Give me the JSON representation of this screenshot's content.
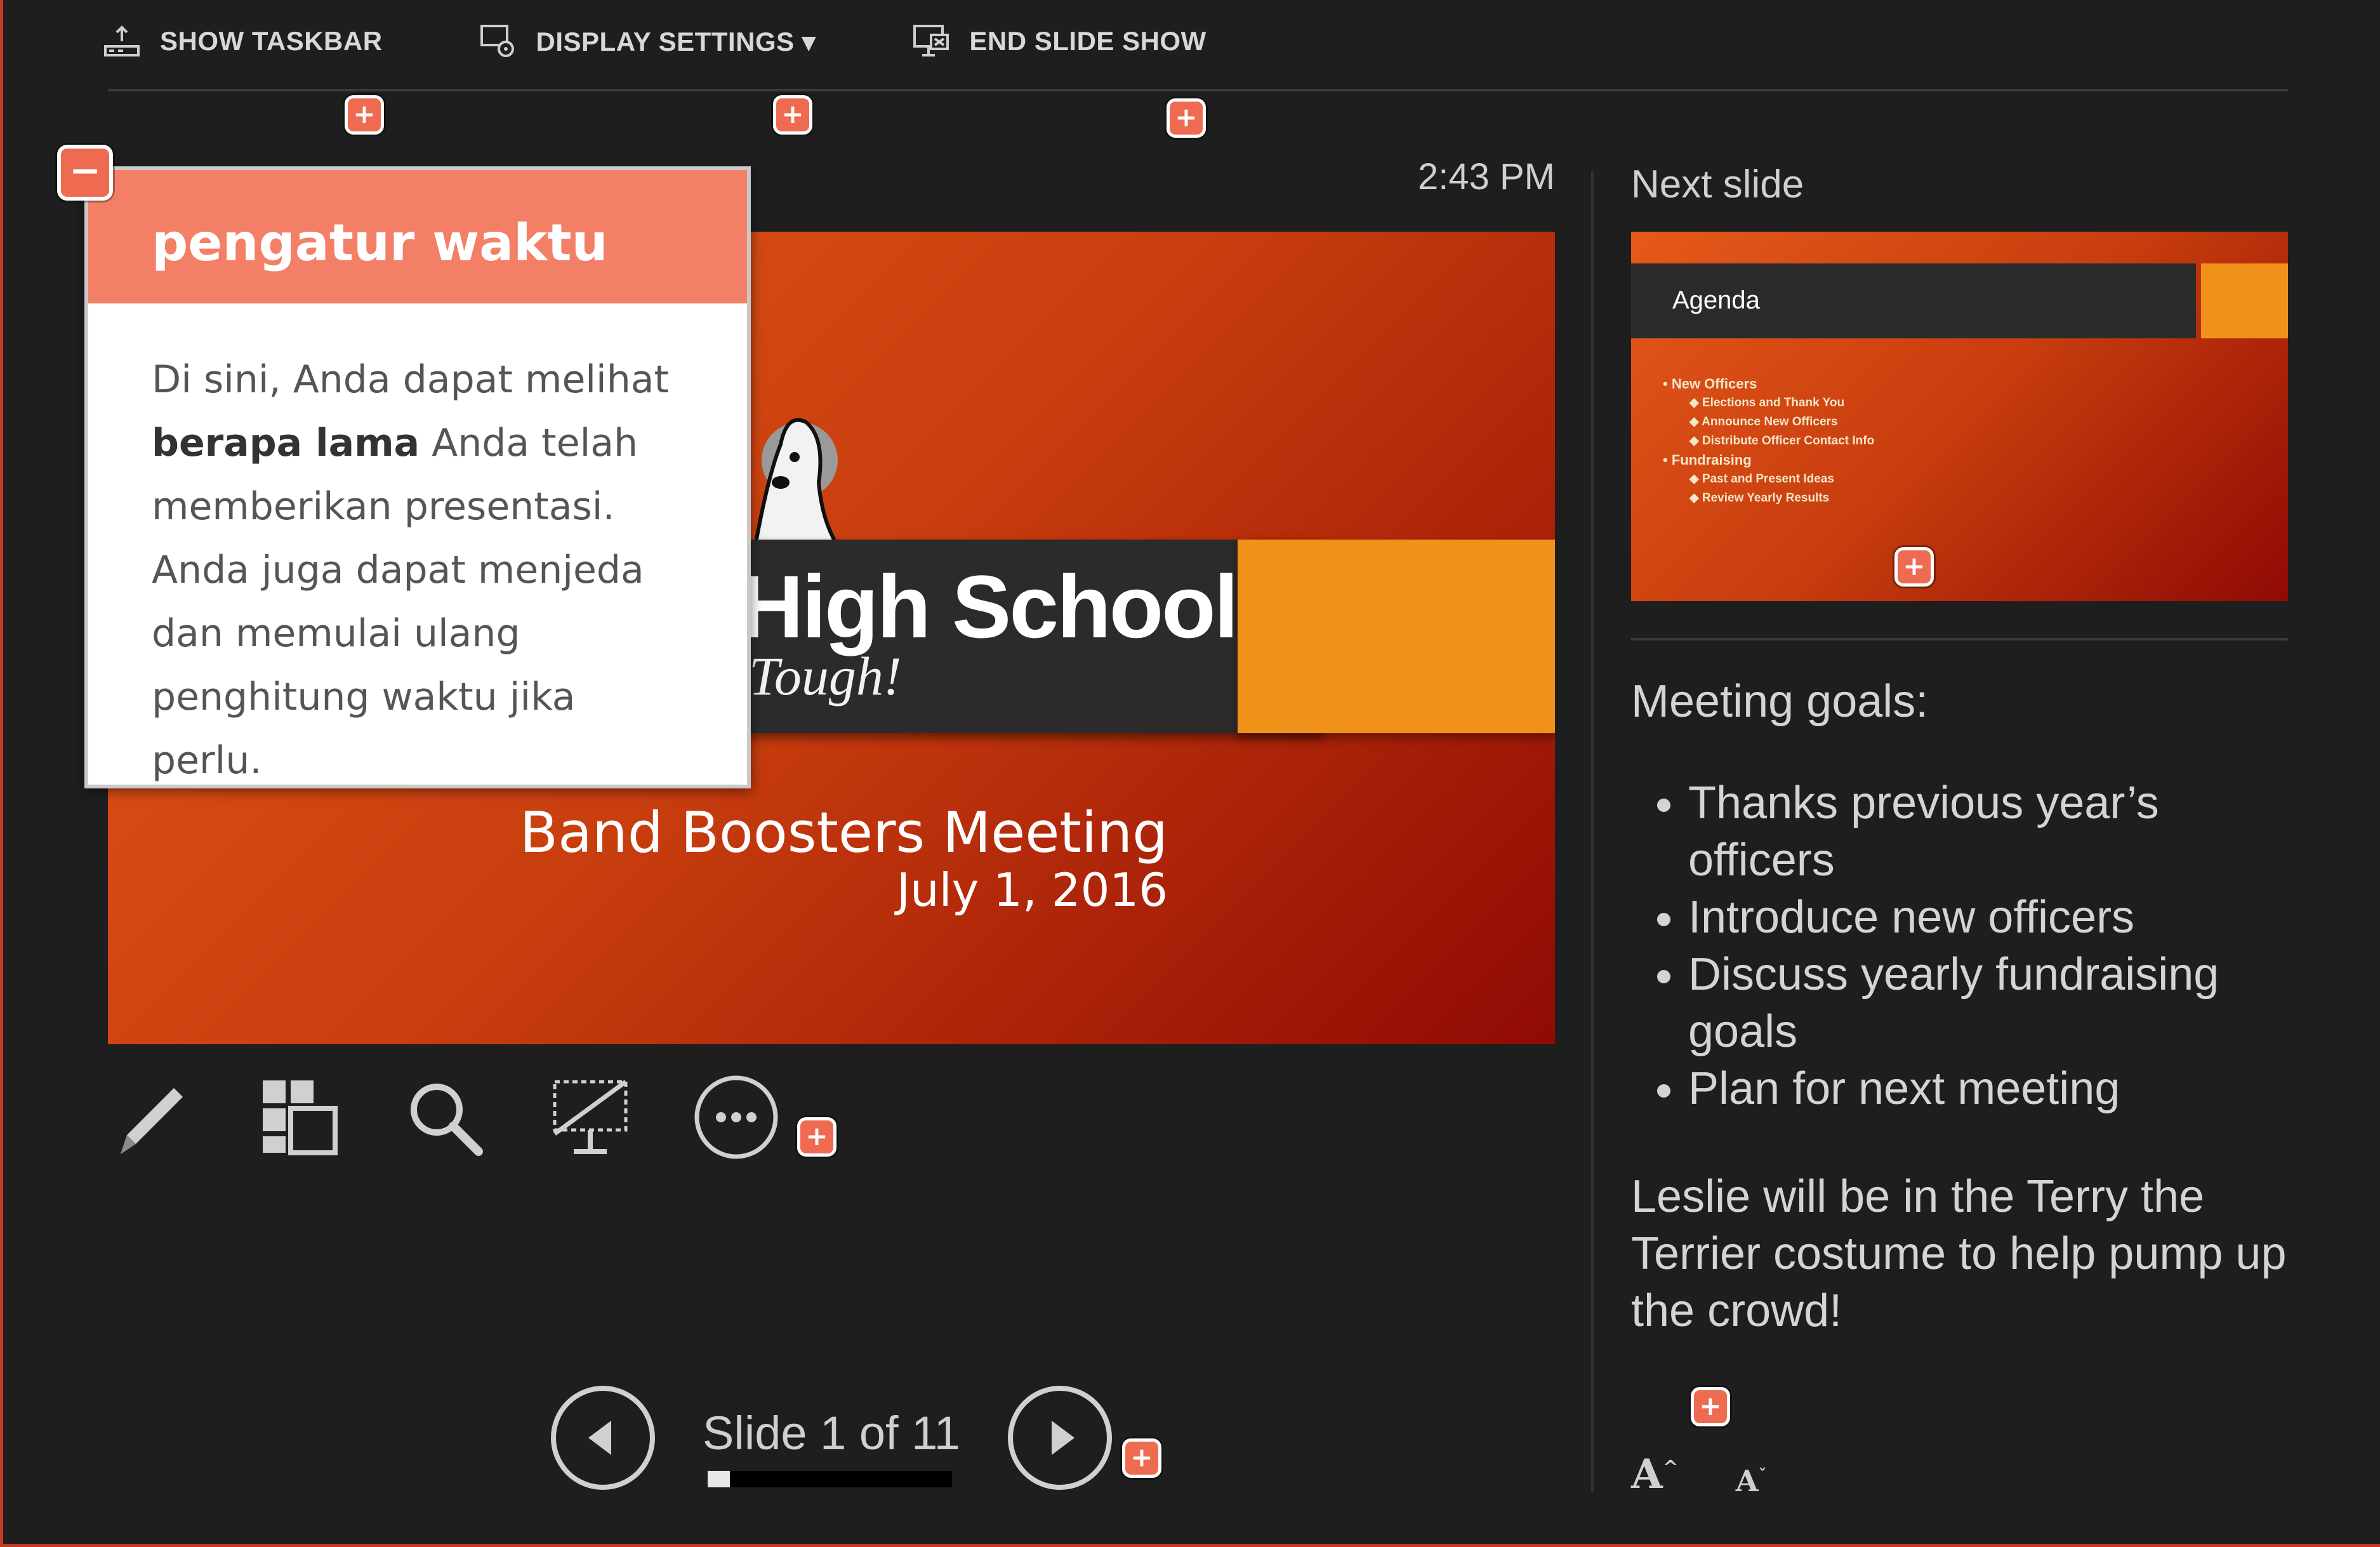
{
  "toolbar": {
    "show_taskbar": "SHOW TASKBAR",
    "display_settings": "DISPLAY SETTINGS ▾",
    "end_slide_show": "END SLIDE SHOW"
  },
  "clock": "2:43 PM",
  "current_slide": {
    "school_name": "High School",
    "tagline": "Tough!",
    "meeting_title": "Band Boosters Meeting",
    "meeting_date": "July 1, 2016"
  },
  "tooltip": {
    "title": "pengatur waktu",
    "close_symbol": "−",
    "text_before": "Di sini, Anda dapat melihat ",
    "text_bold": "berapa lama",
    "text_after": " Anda telah memberikan presentasi. Anda juga dapat menjeda dan memulai ulang penghitung waktu jika perlu."
  },
  "hotspot_symbol": "+",
  "tools": [
    "pen-icon",
    "see-all-slides-icon",
    "zoom-icon",
    "black-screen-icon",
    "more-options-icon"
  ],
  "navigation": {
    "counter": "Slide 1 of 11",
    "progress": 0.09
  },
  "next_slide": {
    "label": "Next slide",
    "title": "Agenda",
    "bullets": [
      {
        "text": "• New Officers",
        "level": 1
      },
      {
        "text": "◆ Elections and Thank You",
        "level": 2
      },
      {
        "text": "◆ Announce New Officers",
        "level": 2
      },
      {
        "text": "◆ Distribute Officer Contact Info",
        "level": 2
      },
      {
        "text": "• Fundraising",
        "level": 1
      },
      {
        "text": "◆ Past and Present Ideas",
        "level": 2
      },
      {
        "text": "◆ Review Yearly Results",
        "level": 2
      }
    ]
  },
  "notes": {
    "heading": "Meeting goals:",
    "items": [
      "Thanks previous year’s officers",
      "Introduce new officers",
      "Discuss yearly fundraising goals",
      "Plan for next meeting"
    ],
    "footer": "Leslie will be in the Terry the Terrier costume to help pump up the crowd!"
  },
  "font_buttons": {
    "increase": "A",
    "decrease": "A"
  },
  "colors": {
    "background": "#1e1e1e",
    "hotspot": "#ee6b52",
    "tooltip_header": "#f37f67",
    "slide_orange": "#f0921a",
    "slide_red": "#8f0a04"
  }
}
